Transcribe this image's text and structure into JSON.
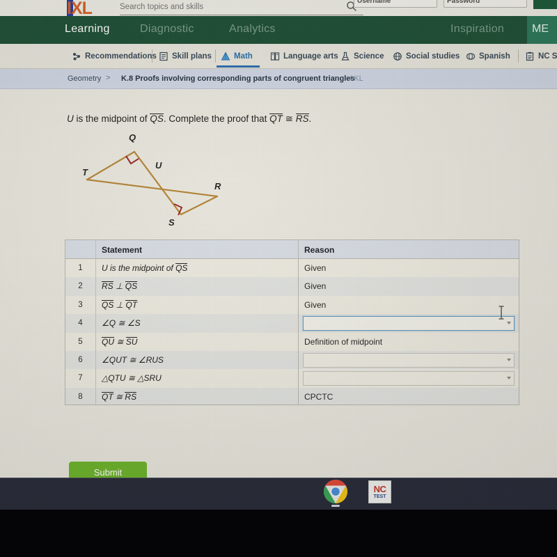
{
  "top_bar": {
    "logo_text": "IXL",
    "search": {
      "placeholder": "Search topics and skills",
      "value": "",
      "icon": "search-icon"
    },
    "username_field": {
      "label": "Username",
      "value": ""
    },
    "password_field": {
      "label": "Password",
      "value": ""
    }
  },
  "nav": {
    "items": [
      {
        "label": "Learning",
        "active": true
      },
      {
        "label": "Diagnostic",
        "active": false
      },
      {
        "label": "Analytics",
        "active": false
      },
      {
        "label": "Inspiration",
        "active": false
      }
    ],
    "member_label": "ME"
  },
  "subject_tabs": [
    {
      "label": "Recommendations",
      "icon": "recommendations-icon",
      "active": false
    },
    {
      "label": "Skill plans",
      "icon": "skill-plans-icon",
      "active": false
    },
    {
      "label": "Math",
      "icon": "math-icon",
      "active": true
    },
    {
      "label": "Language arts",
      "icon": "language-arts-icon",
      "active": false
    },
    {
      "label": "Science",
      "icon": "science-icon",
      "active": false
    },
    {
      "label": "Social studies",
      "icon": "social-studies-icon",
      "active": false
    },
    {
      "label": "Spanish",
      "icon": "spanish-icon",
      "active": false
    },
    {
      "label": "NC Sta",
      "icon": "nc-standards-icon",
      "active": false
    }
  ],
  "breadcrumb": {
    "subject": "Geometry",
    "separator": ">",
    "skill": "K.8 Proofs involving corresponding parts of congruent triangles",
    "code": "AKL"
  },
  "question": {
    "part1": "U",
    "part2": " is the midpoint of ",
    "seg1": "QS",
    "part3": ". Complete the proof that ",
    "seg2": "QT",
    "cong": " ≅ ",
    "seg3": "RS",
    "part4": "."
  },
  "diagram": {
    "labels": [
      "Q",
      "T",
      "U",
      "R",
      "S"
    ],
    "line_color": "#b5873b",
    "right_angle_color": "#9e2f2f",
    "right_angles_at": [
      "Q",
      "S"
    ]
  },
  "table": {
    "headers": {
      "number": "",
      "statement": "Statement",
      "reason": "Reason"
    },
    "rows": [
      {
        "num": "1",
        "statement_html": "<i>U</i> is the midpoint of <span class='ovl'>QS</span>",
        "reason": "Given",
        "reason_type": "text"
      },
      {
        "num": "2",
        "statement_html": "<span class='ovl'>RS</span> ⊥ <span class='ovl'>QS</span>",
        "reason": "Given",
        "reason_type": "text"
      },
      {
        "num": "3",
        "statement_html": "<span class='ovl'>QS</span> ⊥ <span class='ovl'>QT</span>",
        "reason": "Given",
        "reason_type": "text"
      },
      {
        "num": "4",
        "statement_html": "∠Q ≅ ∠S",
        "reason": "",
        "reason_type": "dropdown-focused"
      },
      {
        "num": "5",
        "statement_html": "<span class='ovl'>QU</span> ≅ <span class='ovl'>SU</span>",
        "reason": "Definition of midpoint",
        "reason_type": "text"
      },
      {
        "num": "6",
        "statement_html": "∠QUT ≅ ∠RUS",
        "reason": "",
        "reason_type": "dropdown"
      },
      {
        "num": "7",
        "statement_html": "△QTU ≅ △SRU",
        "reason": "",
        "reason_type": "dropdown"
      },
      {
        "num": "8",
        "statement_html": "<span class='ovl'>QT</span> ≅ <span class='ovl'>RS</span>",
        "reason": "CPCTC",
        "reason_type": "text"
      }
    ]
  },
  "submit": {
    "label": "Submit"
  },
  "taskbar": {
    "items": [
      {
        "name": "chrome",
        "label": ""
      },
      {
        "name": "nctest",
        "label_top": "NC",
        "label_bottom": "TEST"
      }
    ]
  },
  "colors": {
    "nav_green": "#225238",
    "member_green": "#2f7a5c",
    "page_bg": "#e9e7dd",
    "breadcrumb_bg": "#cfd6e2",
    "submit_green": "#6fb52e",
    "math_blue": "#2f6fb0",
    "taskbar": "#2b2e3b"
  }
}
